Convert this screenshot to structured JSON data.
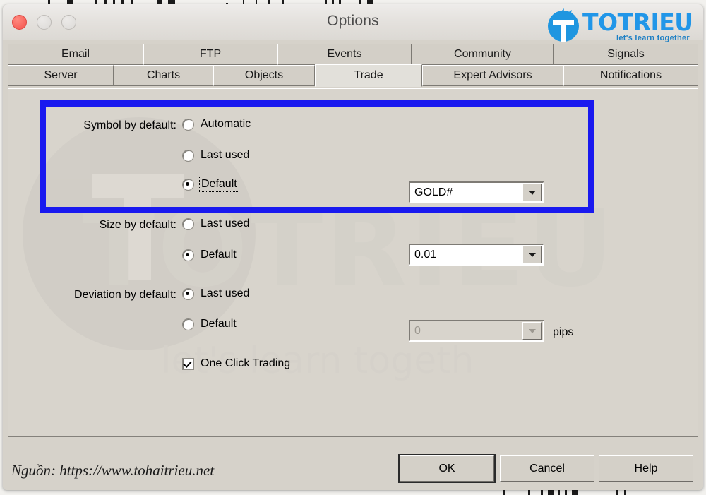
{
  "window": {
    "title": "Options",
    "traffic_lights": [
      "close",
      "minimize",
      "maximize"
    ]
  },
  "logo": {
    "wordmark": "TOTRIEU",
    "tagline": "let's learn together",
    "brand_color": "#2196e8"
  },
  "watermark": {
    "wordmark": "TOTRIEU",
    "tagline": "let's learn togeth"
  },
  "tabs": {
    "row1": [
      {
        "label": "Email",
        "active": false
      },
      {
        "label": "FTP",
        "active": false
      },
      {
        "label": "Events",
        "active": false
      },
      {
        "label": "Community",
        "active": false
      },
      {
        "label": "Signals",
        "active": false
      }
    ],
    "row2": [
      {
        "label": "Server",
        "active": false
      },
      {
        "label": "Charts",
        "active": false
      },
      {
        "label": "Objects",
        "active": false
      },
      {
        "label": "Trade",
        "active": true
      },
      {
        "label": "Expert Advisors",
        "active": false
      },
      {
        "label": "Notifications",
        "active": false
      }
    ]
  },
  "highlight": {
    "color": "#1919ef"
  },
  "form": {
    "symbol": {
      "label": "Symbol by default:",
      "options": [
        {
          "label": "Automatic",
          "selected": false,
          "focused": false
        },
        {
          "label": "Last used",
          "selected": false,
          "focused": false
        },
        {
          "label": "Default",
          "selected": true,
          "focused": true
        }
      ],
      "combo_value": "GOLD#"
    },
    "size": {
      "label": "Size by default:",
      "options": [
        {
          "label": "Last used",
          "selected": false,
          "focused": false
        },
        {
          "label": "Default",
          "selected": true,
          "focused": false
        }
      ],
      "combo_value": "0.01"
    },
    "deviation": {
      "label": "Deviation by default:",
      "options": [
        {
          "label": "Last used",
          "selected": true,
          "focused": false
        },
        {
          "label": "Default",
          "selected": false,
          "focused": false
        }
      ],
      "combo_value": "0",
      "combo_disabled": true,
      "units": "pips"
    },
    "one_click": {
      "label": "One Click Trading",
      "checked": true
    }
  },
  "footer": {
    "source": "Nguồn: https://www.tohaitrieu.net",
    "buttons": [
      {
        "label": "OK",
        "default": true
      },
      {
        "label": "Cancel",
        "default": false
      },
      {
        "label": "Help",
        "default": false
      }
    ]
  }
}
